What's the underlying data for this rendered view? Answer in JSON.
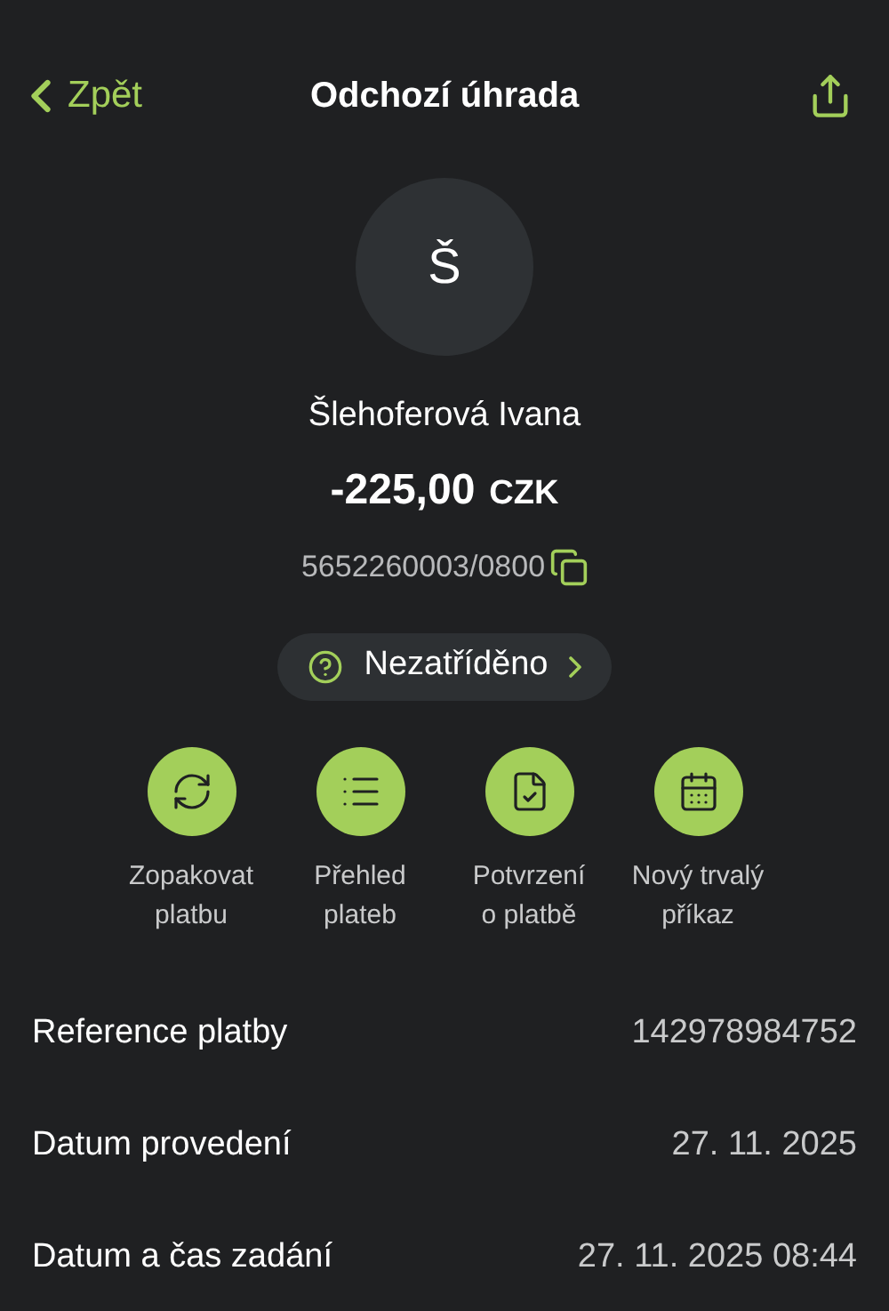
{
  "header": {
    "back": "Zpět",
    "title": "Odchozí úhrada"
  },
  "counterparty": {
    "initial": "Š",
    "name": "Šlehoferová Ivana",
    "amount": "-225,00",
    "currency": "CZK",
    "account": "5652260003/0800"
  },
  "category": {
    "label": "Nezatříděno"
  },
  "actions": [
    {
      "kind": "repeat",
      "label": "Zopakovat\nplatbu"
    },
    {
      "kind": "list",
      "label": "Přehled\nplateb"
    },
    {
      "kind": "confirm",
      "label": "Potvrzení\no platbě"
    },
    {
      "kind": "calendar",
      "label": "Nový trvalý\npříkaz"
    }
  ],
  "details": [
    {
      "label": "Reference platby",
      "value": "142978984752"
    },
    {
      "label": "Datum provedení",
      "value": "27. 11. 2025"
    },
    {
      "label": "Datum a čas zadání",
      "value": "27. 11. 2025 08:44"
    }
  ]
}
